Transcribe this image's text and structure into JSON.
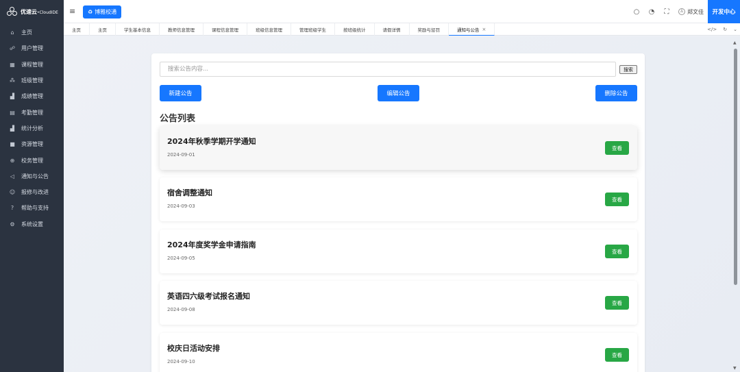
{
  "app": {
    "brand": "优速云",
    "brand_suffix": "CloudIDE",
    "school_button": "博雅校通"
  },
  "sidebar": {
    "items": [
      {
        "label": "主页",
        "icon": "home-icon",
        "glyph": "⌂"
      },
      {
        "label": "用户管理",
        "icon": "users-icon",
        "glyph": "☍"
      },
      {
        "label": "课程管理",
        "icon": "grid-icon",
        "glyph": "▦"
      },
      {
        "label": "班级管理",
        "icon": "class-icon",
        "glyph": "⁂"
      },
      {
        "label": "成绩管理",
        "icon": "bar-chart-icon",
        "glyph": "▟"
      },
      {
        "label": "考勤管理",
        "icon": "calendar-icon",
        "glyph": "▤"
      },
      {
        "label": "统计分析",
        "icon": "stats-icon",
        "glyph": "▟"
      },
      {
        "label": "资源管理",
        "icon": "folder-icon",
        "glyph": "■"
      },
      {
        "label": "校务管理",
        "icon": "globe-icon",
        "glyph": "⊕"
      },
      {
        "label": "通知与公告",
        "icon": "megaphone-icon",
        "glyph": "◁"
      },
      {
        "label": "报修与改进",
        "icon": "smile-icon",
        "glyph": "☺"
      },
      {
        "label": "帮助与支持",
        "icon": "help-icon",
        "glyph": "?"
      },
      {
        "label": "系统设置",
        "icon": "gear-icon",
        "glyph": "⚙"
      }
    ]
  },
  "topbar": {
    "user_name": "郑文佳",
    "dev_center": "开发中心"
  },
  "tabs": [
    {
      "label": "主页"
    },
    {
      "label": "主页"
    },
    {
      "label": "学生基本信息"
    },
    {
      "label": "教师信息管理"
    },
    {
      "label": "课程信息管理"
    },
    {
      "label": "班级信息管理"
    },
    {
      "label": "管理班级学生"
    },
    {
      "label": "按班级统计"
    },
    {
      "label": "请假详情"
    },
    {
      "label": "奖励与惩罚"
    },
    {
      "label": "通知与公告",
      "active": true,
      "closable": true
    }
  ],
  "tab_tools": {
    "code": "</>",
    "refresh": "↻",
    "more": "⌄"
  },
  "notice_panel": {
    "search_placeholder": "搜索公告内容...",
    "search_button": "搜索",
    "new_button": "新建公告",
    "edit_button": "编辑公告",
    "delete_button": "删除公告",
    "list_title": "公告列表",
    "view_label": "查看",
    "notices": [
      {
        "title": "2024年秋季学期开学通知",
        "date": "2024-09-01"
      },
      {
        "title": "宿舍调整通知",
        "date": "2024-09-03"
      },
      {
        "title": "2024年度奖学金申请指南",
        "date": "2024-09-05"
      },
      {
        "title": "英语四六级考试报名通知",
        "date": "2024-09-08"
      },
      {
        "title": "校庆日活动安排",
        "date": "2024-09-10"
      }
    ]
  },
  "colors": {
    "sidebar_bg": "#2b3340",
    "primary": "#1677ff",
    "view_green": "#28a745",
    "content_bg": "#eef1f6"
  }
}
